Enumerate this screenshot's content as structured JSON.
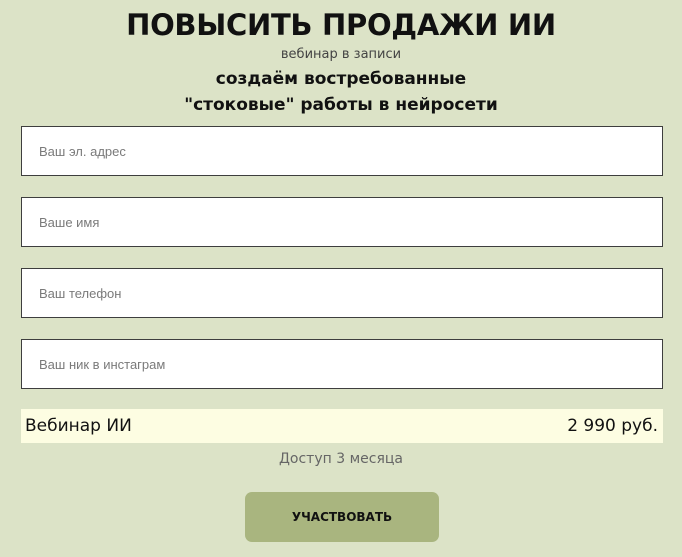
{
  "header": {
    "title": "ПОВЫСИТЬ ПРОДАЖИ ИИ",
    "subtitle": "вебинар в записи",
    "description_line1": "создаём востребованные",
    "description_line2": "\"стоковые\" работы в нейросети"
  },
  "form": {
    "email_placeholder": "Ваш эл. адрес",
    "name_placeholder": "Ваше имя",
    "phone_placeholder": "Ваш телефон",
    "instagram_placeholder": "Ваш ник в инстаграм"
  },
  "product": {
    "name": "Вебинар ИИ",
    "price": "2 990 руб.",
    "access_note": "Доступ 3 месяца"
  },
  "cta": {
    "label": "УЧАСТВОВАТЬ"
  },
  "colors": {
    "background": "#dce3c7",
    "product_row": "#fdfde2",
    "button": "#a9b57f"
  }
}
